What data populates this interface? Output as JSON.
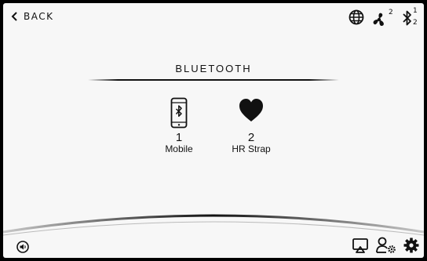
{
  "header": {
    "back_label": "BACK",
    "status_icons": [
      {
        "name": "globe-icon"
      },
      {
        "name": "fan-icon",
        "superscript": "2"
      },
      {
        "name": "bluetooth-status-icon",
        "superscript": "1",
        "subscript": "2"
      }
    ]
  },
  "page": {
    "title": "BLUETOOTH"
  },
  "devices": [
    {
      "icon": "phone-bluetooth-icon",
      "count": "1",
      "label": "Mobile"
    },
    {
      "icon": "heart-icon",
      "count": "2",
      "label": "HR Strap"
    }
  ],
  "footer": {
    "left_icon": "volume-icon",
    "right_icons": [
      "display-icon",
      "user-settings-icon",
      "settings-gear-icon"
    ]
  },
  "colors": {
    "screen_bg": "#f7f7f7",
    "bezel": "#000000",
    "ink": "#111111"
  }
}
